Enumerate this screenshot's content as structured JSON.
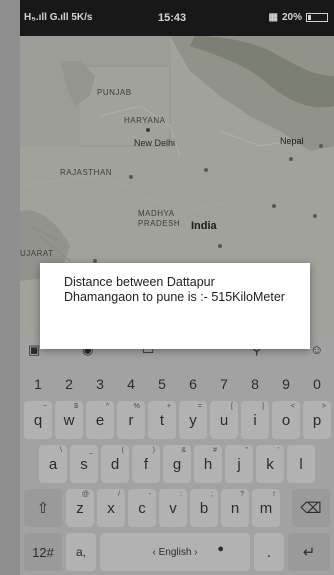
{
  "status_bar": {
    "left": "H₅.ıll G.ıll 5K/s",
    "time": "15:43",
    "battery": "20%"
  },
  "map": {
    "labels": {
      "punjab": "PUNJAB",
      "haryana": "HARYANA",
      "new_delhi": "New Delhi",
      "rajasthan": "RAJASTHAN",
      "nepal": "Nepal",
      "madhya": "MADHYA",
      "pradesh": "PRADESH",
      "india": "India",
      "gujarat": "UJARAT"
    }
  },
  "dialog": {
    "message": "Distance between Dattapur Dhamangaon to pune is :- 515KiloMeter"
  },
  "keyboard": {
    "numbers": [
      "1",
      "2",
      "3",
      "4",
      "5",
      "6",
      "7",
      "8",
      "9",
      "0"
    ],
    "row1": [
      {
        "k": "q",
        "s": "~"
      },
      {
        "k": "w",
        "s": "$"
      },
      {
        "k": "e",
        "s": "^"
      },
      {
        "k": "r",
        "s": "%"
      },
      {
        "k": "t",
        "s": "+"
      },
      {
        "k": "y",
        "s": "="
      },
      {
        "k": "u",
        "s": "["
      },
      {
        "k": "i",
        "s": "]"
      },
      {
        "k": "o",
        "s": "<"
      },
      {
        "k": "p",
        "s": ">"
      }
    ],
    "row2": [
      {
        "k": "a",
        "s": "\\"
      },
      {
        "k": "s",
        "s": "_"
      },
      {
        "k": "d",
        "s": "("
      },
      {
        "k": "f",
        "s": ")"
      },
      {
        "k": "g",
        "s": "&"
      },
      {
        "k": "h",
        "s": "#"
      },
      {
        "k": "j",
        "s": "\""
      },
      {
        "k": "k",
        "s": "'"
      },
      {
        "k": "l",
        "s": ""
      }
    ],
    "row3": [
      {
        "k": "z",
        "s": "@"
      },
      {
        "k": "x",
        "s": "/"
      },
      {
        "k": "c",
        "s": "-"
      },
      {
        "k": "v",
        "s": ":"
      },
      {
        "k": "b",
        "s": ";"
      },
      {
        "k": "n",
        "s": "?"
      },
      {
        "k": "m",
        "s": "!"
      }
    ],
    "bottom": {
      "symbols": "12#",
      "comma": "a,",
      "space": "‹ English ›",
      "period": "."
    }
  }
}
